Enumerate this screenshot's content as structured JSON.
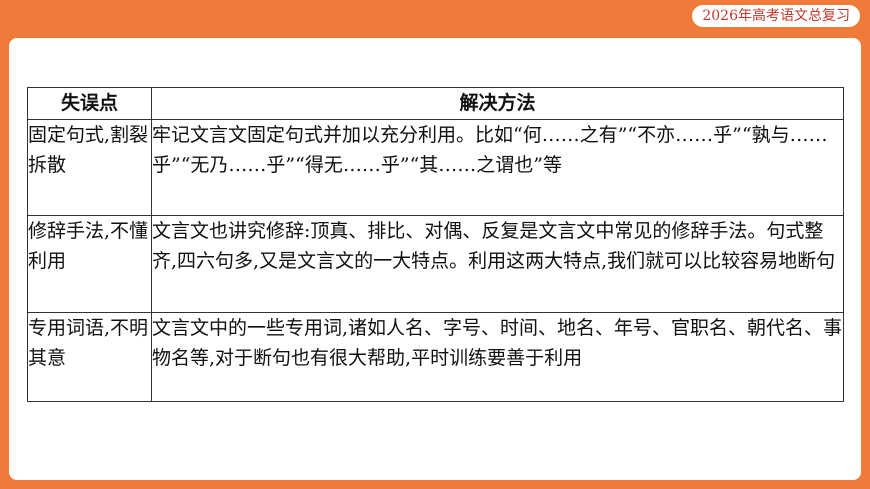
{
  "header": {
    "badge": "2026年高考语文总复习"
  },
  "table": {
    "headers": [
      "失误点",
      "解决方法"
    ],
    "rows": [
      {
        "point": "固定句式,割裂拆散",
        "method": "牢记文言文固定句式并加以充分利用。比如“何……之有”“不亦……乎”“孰与……乎”“无乃……乎”“得无……乎”“其……之谓也”等"
      },
      {
        "point": "修辞手法,不懂利用",
        "method": "文言文也讲究修辞:顶真、排比、对偶、反复是文言文中常见的修辞手法。句式整齐,四六句多,又是文言文的一大特点。利用这两大特点,我们就可以比较容易地断句"
      },
      {
        "point": "专用词语,不明其意",
        "method": "文言文中的一些专用词,诸如人名、字号、时间、地名、年号、官职名、朝代名、事物名等,对于断句也有很大帮助,平时训练要善于利用"
      }
    ]
  }
}
